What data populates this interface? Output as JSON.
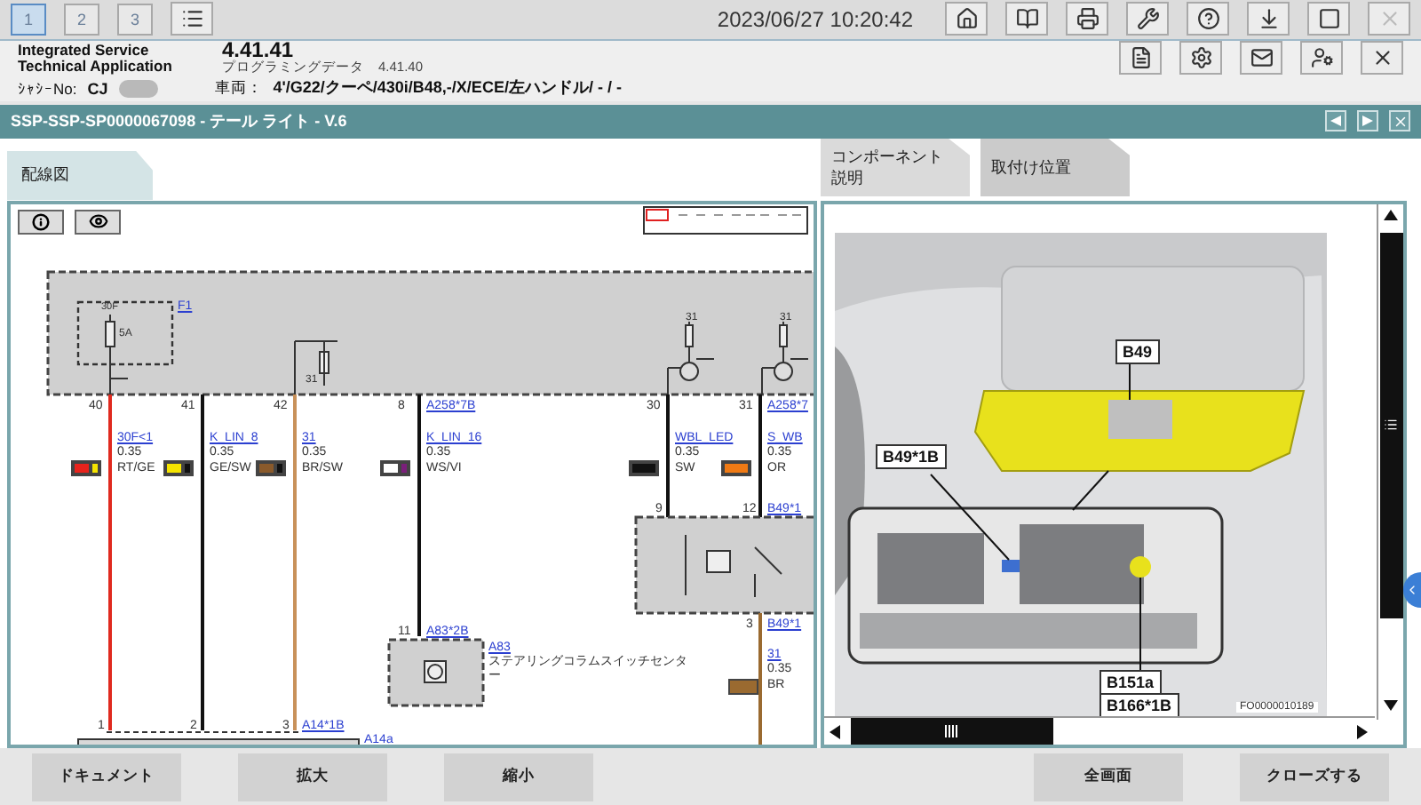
{
  "top_bar": {
    "tabs": [
      {
        "label": "1",
        "selected": true
      },
      {
        "label": "2",
        "selected": false
      },
      {
        "label": "3",
        "selected": false
      }
    ],
    "datetime": "2023/06/27 10:20:42"
  },
  "app": {
    "name": "Integrated Service Technical Application",
    "version": "4.41.41",
    "data_label": "プログラミングデータ",
    "data_version": "4.41.40"
  },
  "vehicle": {
    "vin_label": "ｼｬｼｰNo:",
    "vin": "CJ",
    "vehicle_label": "車両：",
    "vehicle": "4'/G22/クーペ/430i/B48,-/X/ECE/左ハンドル/ - / -"
  },
  "document_title": "SSP-SSP-SP0000067098 - テール ライト - V.6",
  "left_tabs": [
    {
      "label": "配線図",
      "selected": true
    }
  ],
  "right_tabs": [
    {
      "label": "コンポーネント説明",
      "selected": false
    },
    {
      "label": "取付け位置",
      "selected": true
    }
  ],
  "wiring": {
    "fuse": {
      "label": "F1",
      "terminal": "30F",
      "rating": "5A"
    },
    "ground_labels": [
      "31",
      "31",
      "31"
    ],
    "wires": [
      {
        "pin": "40",
        "signal": "30F<1",
        "gauge": "0.35",
        "code": "RT/GE",
        "line": {
          "color": "#e02a1f"
        },
        "swatch": [
          {
            "color": "#e8231c"
          },
          {
            "color": "#f5e400"
          }
        ]
      },
      {
        "pin": "41",
        "signal": "K_LIN_8",
        "gauge": "0.35",
        "code": "GE/SW",
        "line": {
          "color": "#111111"
        },
        "swatch": [
          {
            "color": "#f5e400"
          },
          {
            "color": "#111111"
          }
        ]
      },
      {
        "pin": "42",
        "signal": "31",
        "gauge": "0.35",
        "code": "BR/SW",
        "line": {
          "color": "#c8915a"
        },
        "swatch": [
          {
            "color": "#8a5a2b"
          },
          {
            "color": "#111111"
          }
        ]
      },
      {
        "pin": "8",
        "connector": "A258*7B",
        "signal": "K_LIN_16",
        "gauge": "0.35",
        "code": "WS/VI",
        "line": {
          "color": "#111111"
        },
        "swatch": [
          {
            "color": "#ffffff"
          },
          {
            "color": "#7a1f7a"
          }
        ]
      },
      {
        "pin": "30",
        "signal": "WBL_LED",
        "gauge": "0.35",
        "code": "SW",
        "line": {
          "color": "#111111"
        },
        "swatch": [
          {
            "color": "#111111"
          }
        ]
      },
      {
        "pin": "31",
        "connector": "A258*7",
        "signal": "S_WB",
        "gauge": "0.35",
        "code": "OR",
        "line": {
          "color": "#111111"
        },
        "swatch": [
          {
            "color": "#f07a14"
          }
        ]
      }
    ],
    "lower_module": {
      "pins": [
        "9",
        "12"
      ],
      "connector": "B49*1",
      "out_pin": "3",
      "out_connector": "B49*1",
      "out_wire": {
        "signal": "31",
        "gauge": "0.35",
        "code": "BR",
        "color": "#9a6a30"
      }
    },
    "steering_module": {
      "pin": "11",
      "connector": "A83*2B",
      "label": "A83",
      "name": "ステアリングコラムスイッチセンター"
    },
    "bottom_connector": {
      "pins": [
        "1",
        "2",
        "3"
      ],
      "connector": "A14*1B",
      "label": "A14a"
    }
  },
  "location": {
    "callouts": [
      "B49",
      "B49*1B",
      "B151a",
      "B166*1B"
    ],
    "figure_id": "FO0000010189"
  },
  "buttons_left": [
    "ドキュメント",
    "拡大",
    "縮小"
  ],
  "buttons_right": [
    "全画面",
    "クローズする"
  ]
}
